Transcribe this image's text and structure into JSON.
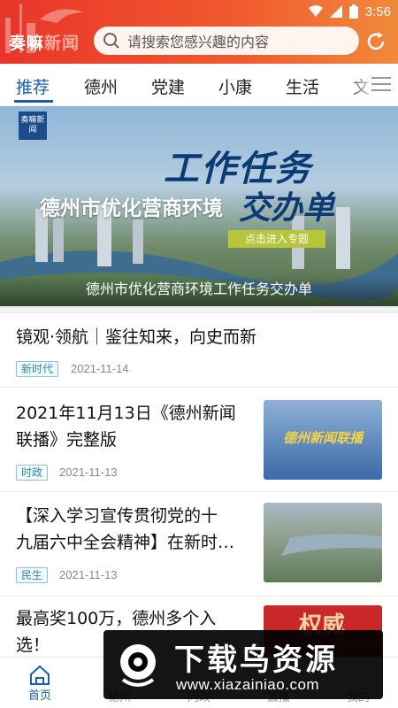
{
  "status": {
    "time": "3:56"
  },
  "header": {
    "logo_main": "奏嘛",
    "logo_dim": "新闻",
    "search_placeholder": "请搜索您感兴趣的内容"
  },
  "tabs": [
    {
      "label": "推荐",
      "active": true
    },
    {
      "label": "德州"
    },
    {
      "label": "党建"
    },
    {
      "label": "小康"
    },
    {
      "label": "生活"
    },
    {
      "label": "文"
    }
  ],
  "banner": {
    "badge": "奏嘛新闻",
    "headline_top": "工作任务",
    "headline_left": "德州市优化营商环境",
    "headline_right": "交办单",
    "enter_label": "点击进入专题",
    "caption": "德州市优化营商环境工作任务交办单"
  },
  "news": [
    {
      "title": "镜观·领航｜鉴往知来，向史而新",
      "tag": "新时代",
      "date": "2021-11-14"
    },
    {
      "title_line1": "2021年11月13日《德州新闻",
      "title_line2": "联播》完整版",
      "tag": "时政",
      "date": "2021-11-13",
      "thumb_text": "德州新闻联播"
    },
    {
      "title_line1": "【深入学习宣传贯彻党的十",
      "title_line2": "九届六中全会精神】在新时…",
      "tag": "民生",
      "date": "2021-11-13"
    },
    {
      "title_line1": "最高奖100万，德州多个入",
      "title_line2": "选！",
      "thumb_text": "权威"
    }
  ],
  "bottom_nav": [
    {
      "label": "首页",
      "active": true
    },
    {
      "label": "德州"
    },
    {
      "label": "问政"
    },
    {
      "label": "直播"
    },
    {
      "label": "我的"
    }
  ],
  "watermark": {
    "title": "下载鸟资源",
    "url": "www.xiazainiao.com"
  },
  "colors": {
    "primary": "#1a5fb4",
    "header": "#e8352a",
    "tag": "#2d85c8"
  }
}
